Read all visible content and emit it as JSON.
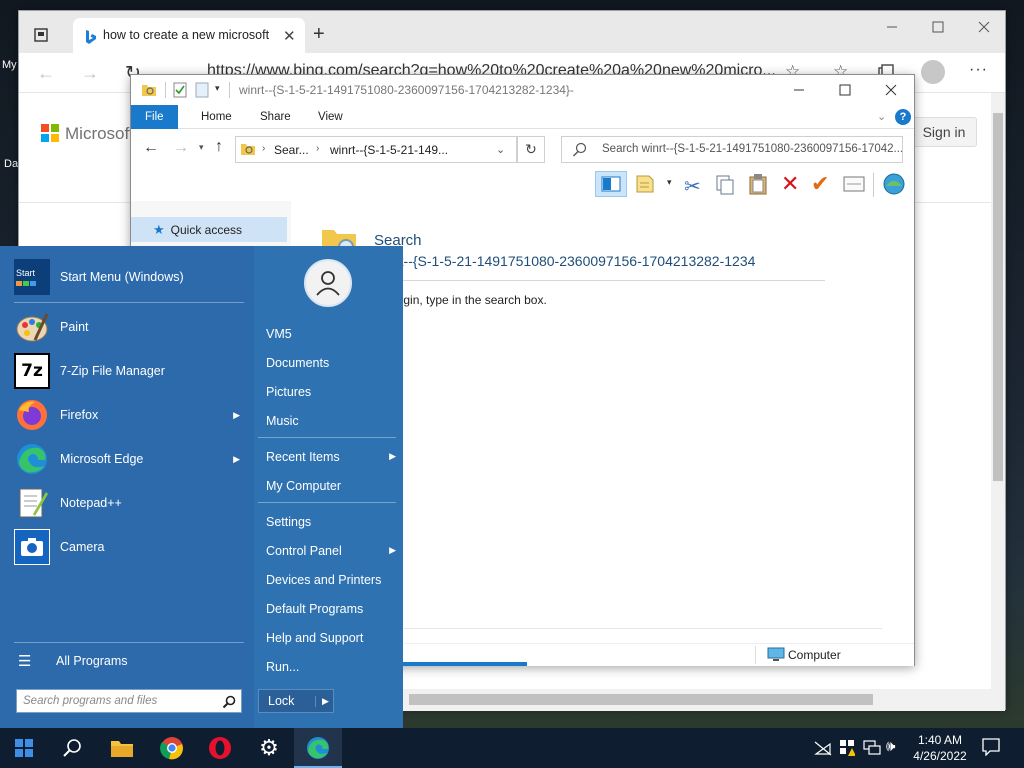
{
  "desktop": {
    "label_top": "My",
    "label_bottom": "Da"
  },
  "edge": {
    "tab_title": "how to create a new microsoft a",
    "url": "https://www.bing.com/search?q=how%20to%20create%20a%20new%20micro...",
    "brand": "Microsoft",
    "signin": "Sign in"
  },
  "explorer": {
    "title": "winrt--{S-1-5-21-1491751080-2360097156-1704213282-1234}-",
    "ribbon_tabs": [
      "File",
      "Home",
      "Share",
      "View"
    ],
    "path": {
      "seg1": "Sear...",
      "seg2": "winrt--{S-1-5-21-149..."
    },
    "search_placeholder": "Search winrt--{S-1-5-21-1491751080-2360097156-17042...",
    "nav": {
      "quick_access": "Quick access"
    },
    "content": {
      "heading": "Search",
      "subheading": "winrt--{S-1-5-21-1491751080-2360097156-1704213282-1234",
      "hint": "To begin, type in the search box."
    },
    "status": {
      "computer": "Computer"
    }
  },
  "start_menu": {
    "left_items": [
      {
        "label": "Start Menu (Windows)",
        "icon": "start-menu-icon"
      },
      {
        "label": "Paint",
        "icon": "paint-icon"
      },
      {
        "label": "7-Zip File Manager",
        "icon": "7zip-icon"
      },
      {
        "label": "Firefox",
        "icon": "firefox-icon",
        "submenu": true
      },
      {
        "label": "Microsoft Edge",
        "icon": "edge-icon",
        "submenu": true
      },
      {
        "label": "Notepad++",
        "icon": "notepadpp-icon"
      },
      {
        "label": "Camera",
        "icon": "camera-icon"
      }
    ],
    "start_icon_text": "Start",
    "all_programs": "All Programs",
    "search_placeholder": "Search programs and files",
    "right_items": [
      "VM5",
      "Documents",
      "Pictures",
      "Music",
      "Recent Items",
      "My Computer",
      "Settings",
      "Control Panel",
      "Devices and Printers",
      "Default Programs",
      "Help and Support",
      "Run..."
    ],
    "lock": "Lock"
  },
  "taskbar": {
    "pinned": [
      "windows-start-icon",
      "search-icon",
      "file-explorer-icon",
      "chrome-icon",
      "opera-icon",
      "settings-icon",
      "edge-icon"
    ],
    "time": "1:40 AM",
    "date": "4/26/2022"
  }
}
